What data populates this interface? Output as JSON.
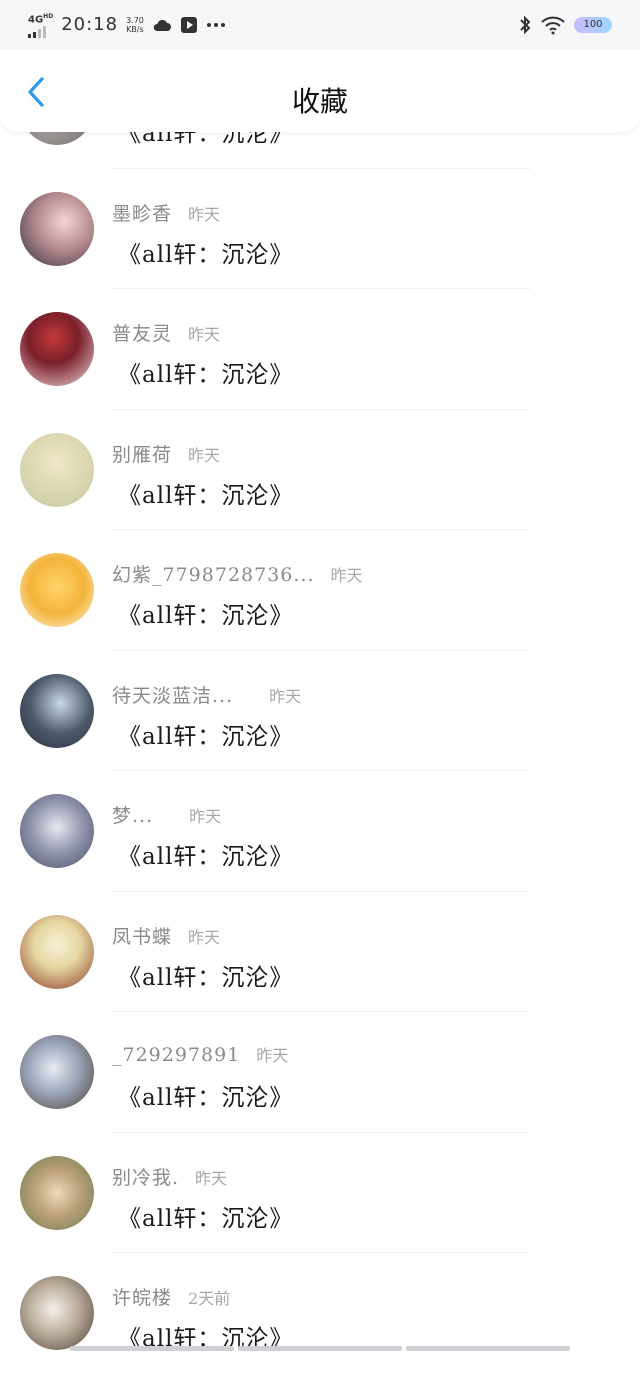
{
  "status_bar": {
    "network": "4G",
    "network_sup": "HD",
    "time": "20:18",
    "speed_value": "3.70",
    "speed_unit": "KB/s",
    "battery": "100"
  },
  "header": {
    "title": "收藏"
  },
  "items": [
    {
      "name": "",
      "when": "",
      "book": "《all轩：沉沦》"
    },
    {
      "name": "墨畛香",
      "when": "昨天",
      "book": "《all轩：沉沦》"
    },
    {
      "name": "普友灵",
      "when": "昨天",
      "book": "《all轩：沉沦》"
    },
    {
      "name": "别雁荷",
      "when": "昨天",
      "book": "《all轩：沉沦》"
    },
    {
      "name": "幻紫_7798728736...",
      "when": "昨天",
      "book": "《all轩：沉沦》"
    },
    {
      "name": "待天淡蓝洁...",
      "when": "昨天",
      "book": "《all轩：沉沦》"
    },
    {
      "name": "梦...",
      "when": "昨天",
      "book": "《all轩：沉沦》"
    },
    {
      "name": "凤书蝶",
      "when": "昨天",
      "book": "《all轩：沉沦》"
    },
    {
      "name": "_729297891",
      "when": "昨天",
      "book": "《all轩：沉沦》"
    },
    {
      "name": "别冷我.",
      "when": "昨天",
      "book": "《all轩：沉沦》"
    },
    {
      "name": "许皖楼",
      "when": "2天前",
      "book": "《all轩：沉沦》"
    }
  ],
  "colors": {
    "accent": "#2b9be6",
    "name_text": "#8a8a8a",
    "time_text": "#a8a8a8"
  },
  "icons": {
    "back": "chevron-left-icon"
  }
}
